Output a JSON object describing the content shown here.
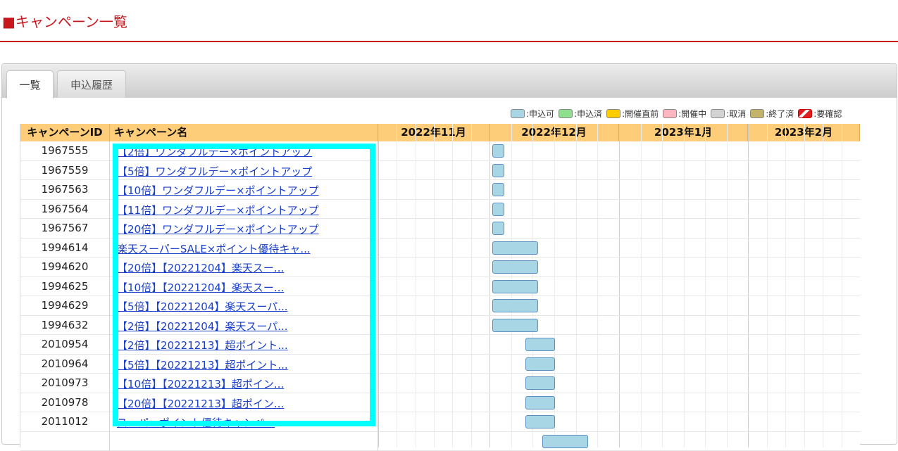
{
  "page": {
    "title": "■キャンペーン一覧"
  },
  "tabs": [
    {
      "label": "一覧"
    },
    {
      "label": "申込履歴"
    }
  ],
  "legend": [
    {
      "label": ":申込可",
      "color": "#a9d6e5"
    },
    {
      "label": ":申込済",
      "color": "#8ee08e"
    },
    {
      "label": ":開催直前",
      "color": "#ffcc00"
    },
    {
      "label": ":開催中",
      "color": "#ffb6c1"
    },
    {
      "label": ":取消",
      "color": "#d3d3d3"
    },
    {
      "label": ":終了済",
      "color": "#c2b469"
    },
    {
      "label": ":要確認",
      "color": "striped-red"
    }
  ],
  "table": {
    "headers": {
      "id": "キャンペーンID",
      "name": "キャンペーン名"
    },
    "months": [
      "2022年11月",
      "2022年12月",
      "2023年1月",
      "2023年2月"
    ],
    "rows": [
      {
        "id": "1967555",
        "name": "【2倍】ワンダフルデー×ポイントアップ"
      },
      {
        "id": "1967559",
        "name": "【5倍】ワンダフルデー×ポイントアップ"
      },
      {
        "id": "1967563",
        "name": "【10倍】ワンダフルデー×ポイントアップ"
      },
      {
        "id": "1967564",
        "name": "【11倍】ワンダフルデー×ポイントアップ"
      },
      {
        "id": "1967567",
        "name": "【20倍】ワンダフルデー×ポイントアップ"
      },
      {
        "id": "1994614",
        "name": "楽天スーパーSALE×ポイント優待キャ..."
      },
      {
        "id": "1994620",
        "name": "【20倍】【20221204】楽天スー..."
      },
      {
        "id": "1994625",
        "name": "【10倍】【20221204】楽天スー..."
      },
      {
        "id": "1994629",
        "name": "【5倍】【20221204】楽天スーパ..."
      },
      {
        "id": "1994632",
        "name": "【2倍】【20221204】楽天スーパ..."
      },
      {
        "id": "2010954",
        "name": "【2倍】【20221213】超ポイント..."
      },
      {
        "id": "2010964",
        "name": "【5倍】【20221213】超ポイント..."
      },
      {
        "id": "2010973",
        "name": "【10倍】【20221213】超ポイン..."
      },
      {
        "id": "2010978",
        "name": "【20倍】【20221213】超ポイン..."
      },
      {
        "id": "2011012",
        "name": "スーパーポイント優待キャンペ..."
      },
      {
        "id": "",
        "name": ""
      }
    ],
    "bars": [
      {
        "row": 0,
        "start": "2022-12-01",
        "end": "2022-12-01",
        "status": "申込可"
      },
      {
        "row": 1,
        "start": "2022-12-01",
        "end": "2022-12-01",
        "status": "申込可"
      },
      {
        "row": 2,
        "start": "2022-12-01",
        "end": "2022-12-01",
        "status": "申込可"
      },
      {
        "row": 3,
        "start": "2022-12-01",
        "end": "2022-12-01",
        "status": "申込可"
      },
      {
        "row": 4,
        "start": "2022-12-01",
        "end": "2022-12-01",
        "status": "申込可"
      },
      {
        "row": 5,
        "start": "2022-12-01",
        "end": "2022-12-11",
        "status": "申込可"
      },
      {
        "row": 6,
        "start": "2022-12-01",
        "end": "2022-12-11",
        "status": "申込可"
      },
      {
        "row": 7,
        "start": "2022-12-01",
        "end": "2022-12-11",
        "status": "申込可"
      },
      {
        "row": 8,
        "start": "2022-12-01",
        "end": "2022-12-11",
        "status": "申込可"
      },
      {
        "row": 9,
        "start": "2022-12-01",
        "end": "2022-12-11",
        "status": "申込可"
      },
      {
        "row": 10,
        "start": "2022-12-09",
        "end": "2022-12-15",
        "status": "申込可"
      },
      {
        "row": 11,
        "start": "2022-12-09",
        "end": "2022-12-15",
        "status": "申込可"
      },
      {
        "row": 12,
        "start": "2022-12-09",
        "end": "2022-12-15",
        "status": "申込可"
      },
      {
        "row": 13,
        "start": "2022-12-09",
        "end": "2022-12-15",
        "status": "申込可"
      },
      {
        "row": 14,
        "start": "2022-12-09",
        "end": "2022-12-15",
        "status": "申込可"
      },
      {
        "row": 15,
        "start": "2022-12-13",
        "end": "2022-12-23",
        "status": "申込可"
      }
    ]
  }
}
